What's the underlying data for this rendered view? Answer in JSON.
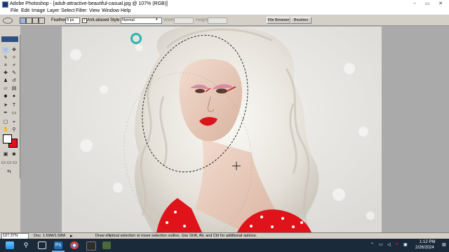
{
  "window": {
    "title": "Adobe Photoshop - [adult-attractive-beautiful-casual.jpg @ 107% (RGB)]"
  },
  "window_controls": {
    "minimize": "−",
    "restore": "▭",
    "close": "✕"
  },
  "menu": [
    "File",
    "Edit",
    "Image",
    "Layer",
    "Select",
    "Filter",
    "View",
    "Window",
    "Help"
  ],
  "options": {
    "feather_label": "Feather:",
    "feather_value": "0 px",
    "antialiased_label": "Anti-aliased",
    "antialiased_checked": true,
    "style_label": "Style:",
    "style_value": "Normal",
    "width_label": "Width:",
    "height_label": "Height:"
  },
  "palette_well": [
    "File Browser",
    "Brushes"
  ],
  "colors": {
    "foreground": "#ffffff",
    "background": "#e0131a",
    "accent_cursor": "#2bb5b0"
  },
  "status": {
    "zoom": "107.37%",
    "doc": "Doc: 1.59M/1.59M",
    "hint": "Draw elliptical selection or move selection outline. Use Shift, Alt, and Ctrl for additional options."
  },
  "tray": {
    "time": "1:12 PM",
    "date": "2/26/2024"
  },
  "taskbar_icons": [
    "start-icon",
    "search-icon",
    "task-view-icon",
    "explorer-icon",
    "photoshop-icon",
    "chrome-icon",
    "media-icon",
    "app-icon"
  ]
}
